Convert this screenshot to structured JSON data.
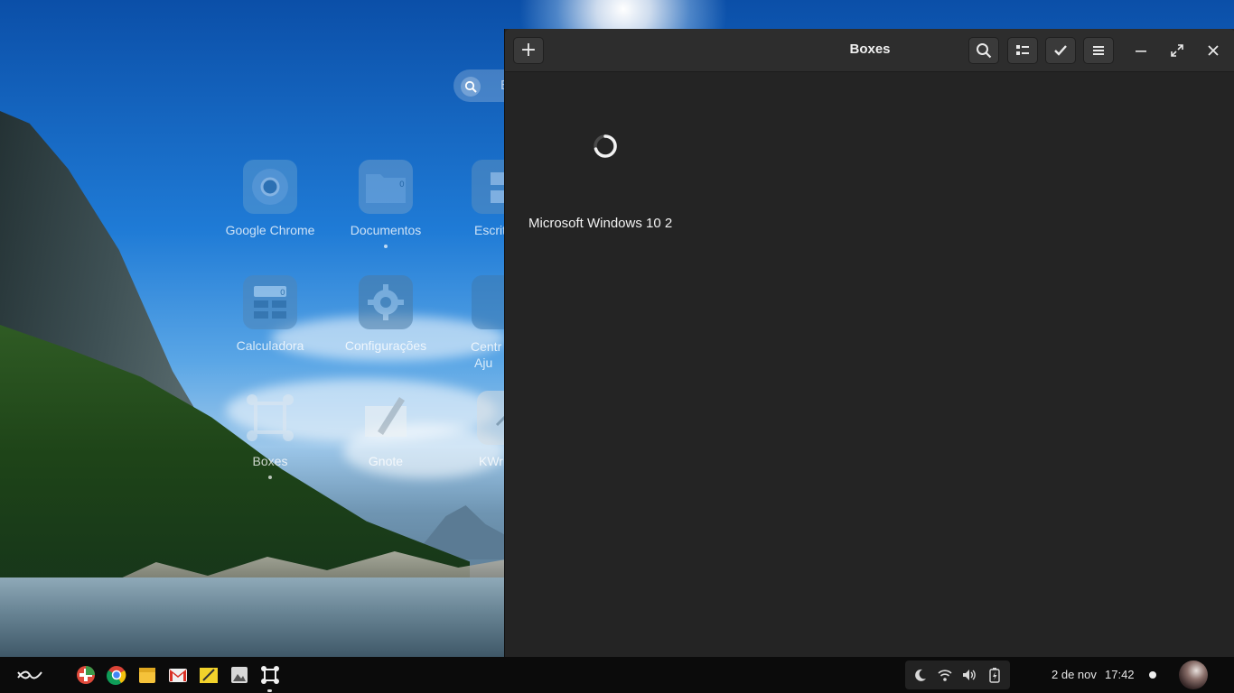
{
  "overview": {
    "search_placeholder": "B",
    "apps": [
      {
        "label": "Google Chrome",
        "icon": "chrome-icon"
      },
      {
        "label": "Documentos",
        "icon": "folder-icon"
      },
      {
        "label": "Escrit",
        "icon": "desktop-icon"
      },
      {
        "label": "Calculadora",
        "icon": "calculator-icon"
      },
      {
        "label": "Configurações",
        "icon": "gear-icon"
      },
      {
        "label": "Centr",
        "label2": "Aju",
        "icon": "help-icon"
      },
      {
        "label": "Boxes",
        "icon": "boxes-icon"
      },
      {
        "label": "Gnote",
        "icon": "note-icon"
      },
      {
        "label": "KWri",
        "icon": "text-editor-icon"
      }
    ]
  },
  "window": {
    "title": "Boxes",
    "new_button": "+",
    "vm": {
      "name": "Microsoft Windows 10 2",
      "state_icon": "loading-spinner-icon"
    },
    "buttons": [
      "search-icon",
      "view-list-icon",
      "select-check-icon",
      "hamburger-menu-icon"
    ],
    "controls": [
      "minimize-icon",
      "maximize-icon",
      "close-icon"
    ]
  },
  "taskbar": {
    "apps": [
      "activities-icon",
      "software-center-icon",
      "chrome-icon",
      "files-icon",
      "gmail-icon",
      "notes-icon",
      "image-viewer-icon",
      "boxes-icon"
    ],
    "tray": [
      "night-light-icon",
      "wifi-icon",
      "volume-icon",
      "battery-icon"
    ],
    "date": "2 de nov",
    "time": "17:42"
  },
  "colors": {
    "window_bg": "#242424",
    "headerbar": "#2d2d2d",
    "taskbar": "#0b0b0b"
  }
}
